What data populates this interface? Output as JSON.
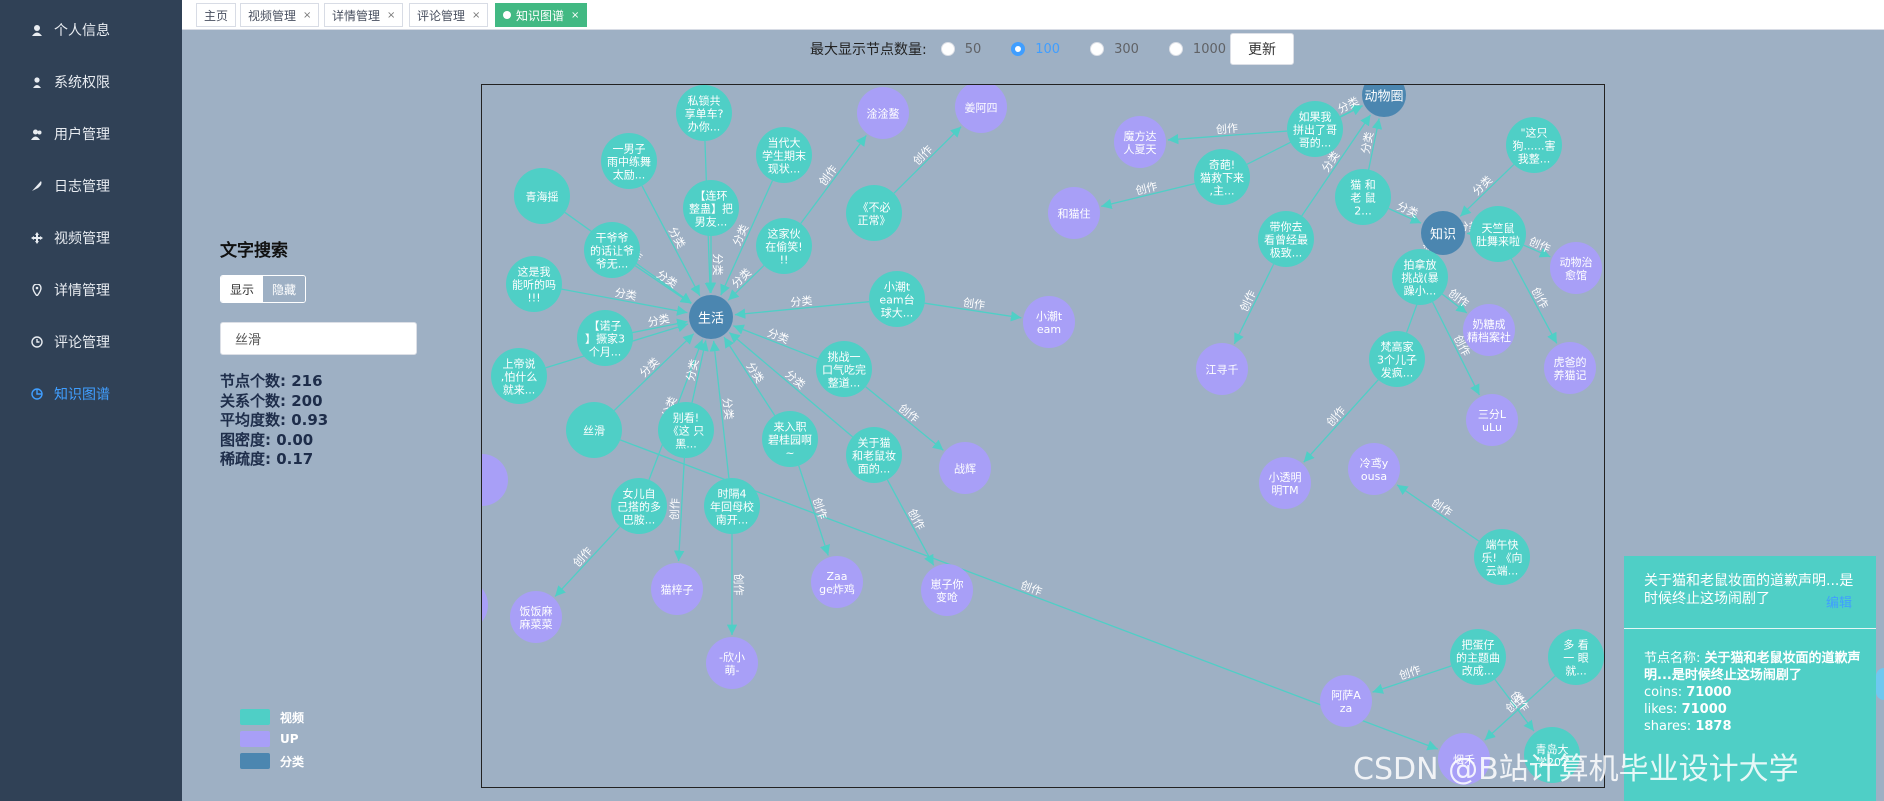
{
  "sidebar": {
    "items": [
      {
        "label": "个人信息",
        "icon": "user-icon"
      },
      {
        "label": "系统权限",
        "icon": "user-lock-icon"
      },
      {
        "label": "用户管理",
        "icon": "users-icon"
      },
      {
        "label": "日志管理",
        "icon": "feather-icon"
      },
      {
        "label": "视频管理",
        "icon": "move-icon"
      },
      {
        "label": "详情管理",
        "icon": "location-icon"
      },
      {
        "label": "评论管理",
        "icon": "clock-icon"
      },
      {
        "label": "知识图谱",
        "icon": "chart-icon",
        "active": true
      }
    ]
  },
  "tabs": [
    {
      "label": "主页"
    },
    {
      "label": "视频管理",
      "close": "×"
    },
    {
      "label": "详情管理",
      "close": "×"
    },
    {
      "label": "评论管理",
      "close": "×"
    },
    {
      "label": "知识图谱",
      "close": "×",
      "active": true
    }
  ],
  "control": {
    "label": "最大显示节点数量:",
    "options": [
      "50",
      "100",
      "300",
      "1000"
    ],
    "selected": "100",
    "update_label": "更新"
  },
  "search": {
    "title": "文字搜索",
    "show_label": "显示",
    "hide_label": "隐藏",
    "value": "丝滑"
  },
  "stats": {
    "node_count": "节点个数:  216",
    "edge_count": "关系个数:  200",
    "avg_degree": "平均度数:  0.93",
    "density": "图密度:  0.00",
    "sparsity": "稀疏度:  0.17"
  },
  "legend": [
    {
      "label": "视频",
      "color": "#4fcfc6"
    },
    {
      "label": "UP",
      "color": "#a89ff7"
    },
    {
      "label": "分类",
      "color": "#4b86b0"
    }
  ],
  "colors": {
    "video": "#4fcfc6",
    "up": "#a89ff7",
    "category": "#4b86b0",
    "edge": "#4fcfc6"
  },
  "graph": {
    "nodes": [
      {
        "id": "life",
        "type": "category",
        "lines": [
          "生活"
        ]
      },
      {
        "id": "knowledge",
        "type": "category",
        "lines": [
          "知识"
        ]
      },
      {
        "id": "zoo",
        "type": "category",
        "lines": [
          "动物圈"
        ]
      },
      {
        "id": "v1",
        "type": "video",
        "lines": [
          "私锁共",
          "享单车?",
          "办你..."
        ]
      },
      {
        "id": "v2",
        "type": "video",
        "lines": [
          "一男子",
          "雨中练舞",
          "太励..."
        ]
      },
      {
        "id": "v3",
        "type": "video",
        "lines": [
          "当代大",
          "学生期末",
          "现状..."
        ]
      },
      {
        "id": "v4",
        "type": "video",
        "lines": [
          "【连环",
          "整蛊】把",
          "男友..."
        ]
      },
      {
        "id": "v5",
        "type": "video",
        "lines": [
          "青海摇"
        ]
      },
      {
        "id": "v6",
        "type": "video",
        "lines": [
          "《不必",
          "正常》"
        ]
      },
      {
        "id": "v7",
        "type": "video",
        "lines": [
          "这家伙",
          "在偷笑!",
          "!!"
        ]
      },
      {
        "id": "v8",
        "type": "video",
        "lines": [
          "干爷爷",
          "的话让爷",
          "爷无..."
        ]
      },
      {
        "id": "v9",
        "type": "video",
        "lines": [
          "这是我",
          "能听的吗",
          "!!!"
        ]
      },
      {
        "id": "v10",
        "type": "video",
        "lines": [
          "小潮t",
          "eam台",
          "球大..."
        ]
      },
      {
        "id": "v11",
        "type": "video",
        "lines": [
          "【诺子",
          "】撅家3",
          "个月..."
        ]
      },
      {
        "id": "v12",
        "type": "video",
        "lines": [
          "上帝说",
          ",怕什么",
          "就来..."
        ]
      },
      {
        "id": "v13",
        "type": "video",
        "lines": [
          "挑战一",
          "口气吃完",
          "整道..."
        ]
      },
      {
        "id": "v14",
        "type": "video",
        "lines": [
          "丝滑"
        ]
      },
      {
        "id": "v15",
        "type": "video",
        "lines": [
          "别看!",
          "《这 只",
          "黑..."
        ]
      },
      {
        "id": "v16",
        "type": "video",
        "lines": [
          "来入职",
          "碧桂园啊",
          "~"
        ]
      },
      {
        "id": "v17",
        "type": "video",
        "lines": [
          "关于猫",
          "和老鼠妆",
          "面的..."
        ]
      },
      {
        "id": "v18",
        "type": "video",
        "lines": [
          "女儿自",
          "己搭的多",
          "巴胺..."
        ]
      },
      {
        "id": "v19",
        "type": "video",
        "lines": [
          "时隔4",
          "年回母校",
          "南开..."
        ]
      },
      {
        "id": "v20",
        "type": "video",
        "lines": [
          "如果我",
          "拼出了哥",
          "哥的..."
        ]
      },
      {
        "id": "v21",
        "type": "video",
        "lines": [
          "\"这只",
          "狗......害",
          "我整..."
        ]
      },
      {
        "id": "v22",
        "type": "video",
        "lines": [
          "奇葩!",
          "猫救下来",
          ",主..."
        ]
      },
      {
        "id": "v23",
        "type": "video",
        "lines": [
          "猫 和",
          "老 鼠",
          "2..."
        ]
      },
      {
        "id": "v24",
        "type": "video",
        "lines": [
          "带你去",
          "看曾经最",
          "极致..."
        ]
      },
      {
        "id": "v25",
        "type": "video",
        "lines": [
          "天竺鼠",
          "肚舞来啦"
        ]
      },
      {
        "id": "v26",
        "type": "video",
        "lines": [
          "拍拿放",
          "挑战(暴",
          "躁小..."
        ]
      },
      {
        "id": "v27",
        "type": "video",
        "lines": [
          "梵高家",
          "3个儿子",
          "发疯..."
        ]
      },
      {
        "id": "v28",
        "type": "video",
        "lines": [
          "端午快",
          "乐! 《向",
          "云端..."
        ]
      },
      {
        "id": "v29",
        "type": "video",
        "lines": [
          "把蛋仔",
          "的主题曲",
          "改成..."
        ]
      },
      {
        "id": "v30",
        "type": "video",
        "lines": [
          "多 看",
          "一 眼",
          "就..."
        ]
      },
      {
        "id": "u1",
        "type": "up",
        "lines": [
          "淦淦鳌"
        ]
      },
      {
        "id": "u2",
        "type": "up",
        "lines": [
          "姜阿四"
        ]
      },
      {
        "id": "u3",
        "type": "up",
        "lines": [
          "小潮t",
          "eam"
        ]
      },
      {
        "id": "u4",
        "type": "up",
        "lines": [
          "战辉"
        ]
      },
      {
        "id": "u5",
        "type": "up",
        "lines": [
          "Zaa",
          "ge炸鸡"
        ]
      },
      {
        "id": "u6",
        "type": "up",
        "lines": [
          "崽子你",
          "变呛"
        ]
      },
      {
        "id": "u7",
        "type": "up",
        "lines": [
          "猫梓子"
        ]
      },
      {
        "id": "u8",
        "type": "up",
        "lines": [
          "-欣小",
          "萌-"
        ]
      },
      {
        "id": "u9",
        "type": "up",
        "lines": [
          "饭饭麻",
          "麻菜菜"
        ]
      },
      {
        "id": "u10",
        "type": "up",
        "lines": [
          "魔方达",
          "人夏天"
        ]
      },
      {
        "id": "u11",
        "type": "up",
        "lines": [
          "和猫住"
        ]
      },
      {
        "id": "u12",
        "type": "up",
        "lines": [
          "江寻千"
        ]
      },
      {
        "id": "u13",
        "type": "up",
        "lines": [
          "奶糖成",
          "精档案社"
        ]
      },
      {
        "id": "u14",
        "type": "up",
        "lines": [
          "三分L",
          "uLu"
        ]
      },
      {
        "id": "u15",
        "type": "up",
        "lines": [
          "动物治",
          "愈馆"
        ]
      },
      {
        "id": "u16",
        "type": "up",
        "lines": [
          "虎爸的",
          "养猫记"
        ]
      },
      {
        "id": "u17",
        "type": "up",
        "lines": [
          "小透明",
          "明TM"
        ]
      },
      {
        "id": "u18",
        "type": "up",
        "lines": [
          "冷鸢y",
          "ousa"
        ]
      },
      {
        "id": "u19",
        "type": "up",
        "lines": [
          "阿萨A",
          "za"
        ]
      },
      {
        "id": "u20",
        "type": "up",
        "lines": [
          "烟禾"
        ]
      },
      {
        "id": "v31",
        "type": "video",
        "lines": [
          "青岛大",
          "学202"
        ]
      }
    ],
    "edges": [
      {
        "from": "v1",
        "to": "life",
        "label": "分类"
      },
      {
        "from": "v2",
        "to": "life",
        "label": "分类"
      },
      {
        "from": "v3",
        "to": "life",
        "label": "分类"
      },
      {
        "from": "v4",
        "to": "life",
        "label": "分类"
      },
      {
        "from": "v7",
        "to": "life",
        "label": "分类"
      },
      {
        "from": "v8",
        "to": "life",
        "label": "分类"
      },
      {
        "from": "v9",
        "to": "life",
        "label": "分类"
      },
      {
        "from": "v10",
        "to": "life",
        "label": "分类"
      },
      {
        "from": "v11",
        "to": "life",
        "label": "分类"
      },
      {
        "from": "v12",
        "to": "life",
        "label": "分类"
      },
      {
        "from": "v13",
        "to": "life",
        "label": "分类"
      },
      {
        "from": "v15",
        "to": "life",
        "label": "分类"
      },
      {
        "from": "v16",
        "to": "life",
        "label": "分类"
      },
      {
        "from": "v17",
        "to": "life",
        "label": "分类"
      },
      {
        "from": "v18",
        "to": "life",
        "label": "分类"
      },
      {
        "from": "v19",
        "to": "life",
        "label": "分类"
      },
      {
        "from": "v14",
        "to": "life",
        "label": "分类"
      },
      {
        "from": "v6",
        "to": "u2",
        "label": "创作"
      },
      {
        "from": "v7",
        "to": "u1",
        "label": "创作"
      },
      {
        "from": "v10",
        "to": "u3",
        "label": "创作"
      },
      {
        "from": "v13",
        "to": "u4",
        "label": "创作"
      },
      {
        "from": "v16",
        "to": "u5",
        "label": "创作"
      },
      {
        "from": "v17",
        "to": "u6",
        "label": "创作"
      },
      {
        "from": "v18",
        "to": "u9",
        "label": "创作"
      },
      {
        "from": "v15",
        "to": "u7",
        "label": "创作"
      },
      {
        "from": "v19",
        "to": "u8",
        "label": "创作"
      },
      {
        "from": "v20",
        "to": "u10",
        "label": "创作"
      },
      {
        "from": "v22",
        "to": "u11",
        "label": "创作"
      },
      {
        "from": "v24",
        "to": "u12",
        "label": "创作"
      },
      {
        "from": "v27",
        "to": "u17",
        "label": "创作"
      },
      {
        "from": "v28",
        "to": "u18",
        "label": "创作"
      },
      {
        "from": "v29",
        "to": "u19",
        "label": "创作"
      },
      {
        "from": "v30",
        "to": "u20",
        "label": "创作"
      },
      {
        "from": "v26",
        "to": "u13",
        "label": "创作"
      },
      {
        "from": "v26",
        "to": "u14",
        "label": "创作"
      },
      {
        "from": "v25",
        "to": "u15",
        "label": "创作"
      },
      {
        "from": "v25",
        "to": "u16",
        "label": "创作"
      },
      {
        "from": "v20",
        "to": "zoo",
        "label": "分类"
      },
      {
        "from": "v23",
        "to": "zoo",
        "label": "分类"
      },
      {
        "from": "v23",
        "to": "knowledge",
        "label": "分类"
      },
      {
        "from": "v21",
        "to": "knowledge",
        "label": "分类"
      },
      {
        "from": "v25",
        "to": "knowledge",
        "label": "分类"
      },
      {
        "from": "v26",
        "to": "knowledge",
        "label": "分类"
      },
      {
        "from": "v22",
        "to": "zoo",
        "label": "分类"
      },
      {
        "from": "v24",
        "to": "zoo",
        "label": "分类"
      },
      {
        "from": "v27",
        "to": "knowledge",
        "label": "分类"
      },
      {
        "from": "v28",
        "to": "v28",
        "label": "分类"
      },
      {
        "from": "v5",
        "to": "life",
        "label": "创作"
      },
      {
        "from": "v14",
        "to": "u20",
        "label": "创作"
      },
      {
        "from": "v29",
        "to": "v31",
        "label": "创作"
      }
    ]
  },
  "tooltip": {
    "title": "关于猫和老鼠妆面的道歉声明...是时候终止这场闹剧了",
    "edit_label": "编辑",
    "name_label": "节点名称:",
    "name_value": "关于猫和老鼠妆面的道歉声明...是时候终止这场闹剧了",
    "coins_label": "coins:",
    "coins_value": "71000",
    "likes_label": "likes:",
    "likes_value": "71000",
    "shares_label": "shares:",
    "shares_value": "1878"
  },
  "watermark": "CSDN @B站计算机毕业设计大学"
}
